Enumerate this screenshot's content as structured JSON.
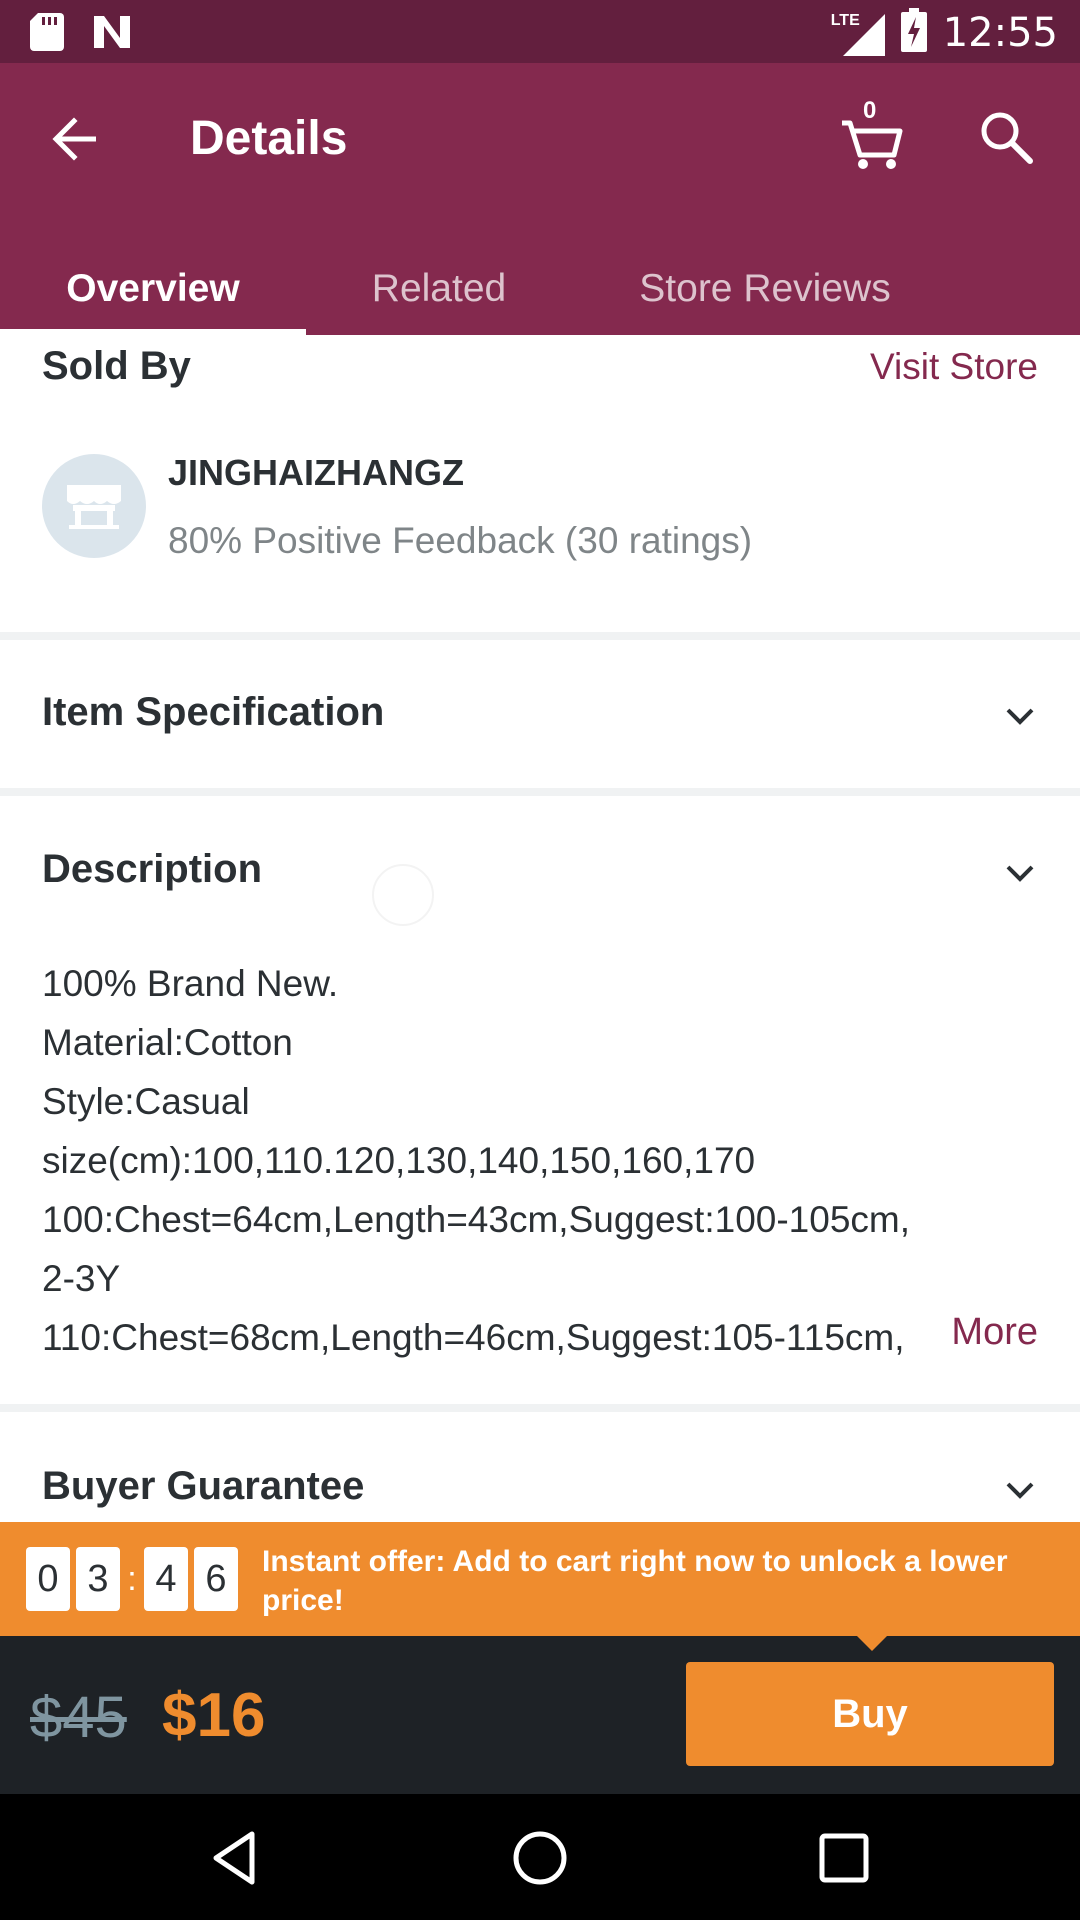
{
  "status_bar": {
    "network": "LTE",
    "time": "12:55",
    "icons": [
      "sd-card-icon",
      "n-notification-icon",
      "signal-icon",
      "battery-charging-icon"
    ]
  },
  "header": {
    "title": "Details",
    "cart_count": "0",
    "icons": [
      "back-arrow-icon",
      "cart-icon",
      "search-icon"
    ]
  },
  "tabs": [
    {
      "label": "Overview",
      "active": true
    },
    {
      "label": "Related",
      "active": false
    },
    {
      "label": "Store Reviews",
      "active": false
    }
  ],
  "sold_by": {
    "title": "Sold By",
    "visit_store": "Visit Store",
    "store_name": "JINGHAIZHANGZ",
    "feedback": "80% Positive Feedback (30 ratings)"
  },
  "sections": {
    "item_specification": "Item Specification",
    "description": "Description",
    "buyer_guarantee": "Buyer Guarantee"
  },
  "description_lines": [
    "100% Brand New.",
    "Material:Cotton",
    "Style:Casual",
    "size(cm):100,110.120,130,140,150,160,170",
    "100:Chest=64cm,Length=43cm,Suggest:100-105cm,",
    "2-3Y",
    "110:Chest=68cm,Length=46cm,Suggest:105-115cm,"
  ],
  "more_label": "More",
  "offer": {
    "timer_digits": [
      "0",
      "3",
      "4",
      "6"
    ],
    "separator": ":",
    "text": "Instant offer: Add to cart right now to unlock a lower price!"
  },
  "purchase": {
    "old_price": "$45",
    "new_price": "$16",
    "buy_label": "Buy"
  },
  "colors": {
    "primary": "#84294e",
    "status_bar": "#631f3e",
    "accent": "#ef8c2e",
    "bottom_bar": "#1e2226"
  }
}
